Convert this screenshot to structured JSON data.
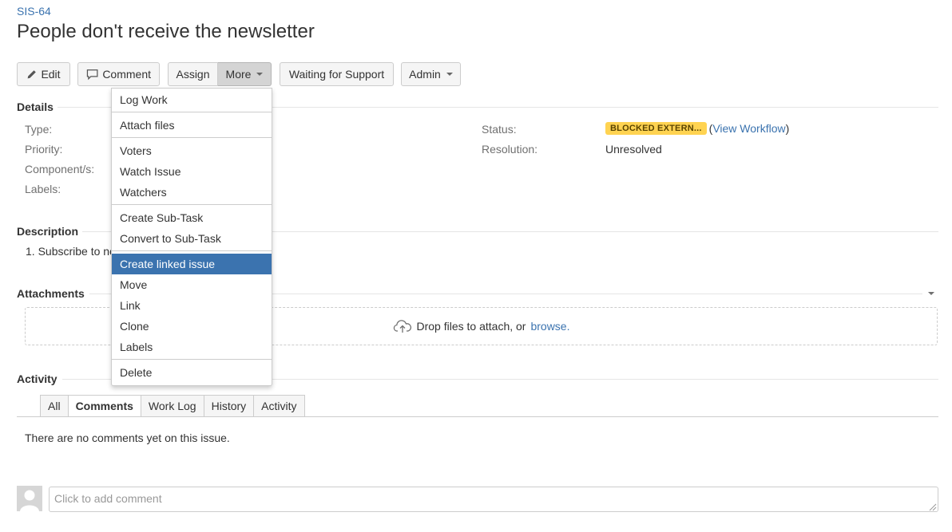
{
  "issue": {
    "key": "SIS-64",
    "title": "People don't receive the newsletter"
  },
  "toolbar": {
    "edit": "Edit",
    "comment": "Comment",
    "assign": "Assign",
    "more": "More",
    "waiting": "Waiting for Support",
    "admin": "Admin"
  },
  "more_menu": {
    "groups": [
      [
        "Log Work"
      ],
      [
        "Attach files"
      ],
      [
        "Voters",
        "Watch Issue",
        "Watchers"
      ],
      [
        "Create Sub-Task",
        "Convert to Sub-Task"
      ],
      [
        "Create linked issue",
        "Move",
        "Link",
        "Clone",
        "Labels"
      ],
      [
        "Delete"
      ]
    ],
    "highlighted": "Create linked issue"
  },
  "details": {
    "heading": "Details",
    "labels": {
      "type": "Type:",
      "priority": "Priority:",
      "components": "Component/s:",
      "labels": "Labels:",
      "status": "Status:",
      "resolution": "Resolution:"
    },
    "status": "BLOCKED EXTERN...",
    "status_color": "#ffd351",
    "view_workflow": "View Workflow",
    "resolution": "Unresolved"
  },
  "description": {
    "heading": "Description",
    "text": "1. Subscribe to ne"
  },
  "attachments": {
    "heading": "Attachments",
    "drop_text": "Drop files to attach, or",
    "browse": "browse."
  },
  "activity": {
    "heading": "Activity",
    "tabs": [
      "All",
      "Comments",
      "Work Log",
      "History",
      "Activity"
    ],
    "selected_tab": "Comments",
    "empty_text": "There are no comments yet on this issue."
  },
  "comment_box": {
    "placeholder": "Click to add comment"
  },
  "colors": {
    "link": "#3b73af",
    "highlight": "#3b73af"
  }
}
